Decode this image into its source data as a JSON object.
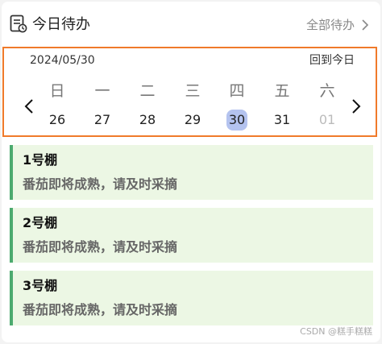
{
  "header": {
    "title": "今日待办",
    "all_todos_label": "全部待办",
    "icon": "document-icon"
  },
  "calendar": {
    "current_date": "2024/05/30",
    "back_to_today": "回到今日",
    "weekdays": [
      "日",
      "一",
      "二",
      "三",
      "四",
      "五",
      "六"
    ],
    "days": [
      {
        "label": "26"
      },
      {
        "label": "27"
      },
      {
        "label": "28"
      },
      {
        "label": "29"
      },
      {
        "label": "30"
      },
      {
        "label": "31"
      },
      {
        "label": "01"
      }
    ],
    "selected_day": "30",
    "selected_color": "#b4c3ef"
  },
  "tasks": [
    {
      "name": "1号棚",
      "desc": "番茄即将成熟，请及时采摘"
    },
    {
      "name": "2号棚",
      "desc": "番茄即将成熟，请及时采摘"
    },
    {
      "name": "3号棚",
      "desc": "番茄即将成熟，请及时采摘"
    }
  ],
  "colors": {
    "accent_border": "#f07a2a",
    "task_bg": "#ecf7e4",
    "task_bar": "#4caa6f"
  },
  "watermark": "CSDN @糕手糕糕"
}
